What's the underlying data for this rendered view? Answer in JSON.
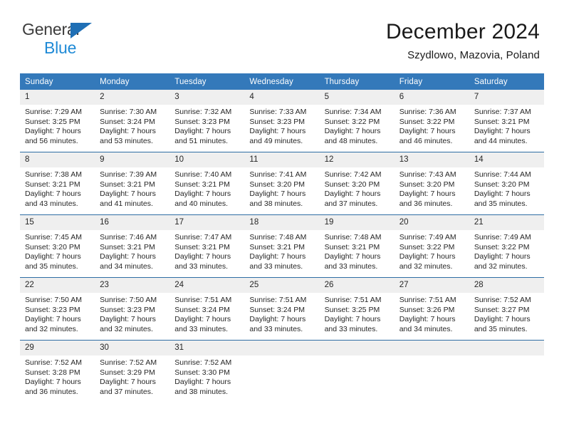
{
  "brand": {
    "line1": "General",
    "line2": "Blue",
    "logo_icon": "triangle-flag-icon",
    "color_dark": "#3c3c3c",
    "color_blue": "#1f8ad6",
    "triangle_color": "#1f6fb5"
  },
  "header": {
    "title": "December 2024",
    "subtitle": "Szydlowo, Mazovia, Poland"
  },
  "theme": {
    "header_bg": "#3479ba",
    "header_text": "#ffffff",
    "daynum_bg": "#efefef",
    "row_divider": "#2e6da4",
    "body_text": "#262626"
  },
  "weekdays": [
    "Sunday",
    "Monday",
    "Tuesday",
    "Wednesday",
    "Thursday",
    "Friday",
    "Saturday"
  ],
  "weeks": [
    [
      {
        "day": "1",
        "sunrise": "Sunrise: 7:29 AM",
        "sunset": "Sunset: 3:25 PM",
        "daylight1": "Daylight: 7 hours",
        "daylight2": "and 56 minutes."
      },
      {
        "day": "2",
        "sunrise": "Sunrise: 7:30 AM",
        "sunset": "Sunset: 3:24 PM",
        "daylight1": "Daylight: 7 hours",
        "daylight2": "and 53 minutes."
      },
      {
        "day": "3",
        "sunrise": "Sunrise: 7:32 AM",
        "sunset": "Sunset: 3:23 PM",
        "daylight1": "Daylight: 7 hours",
        "daylight2": "and 51 minutes."
      },
      {
        "day": "4",
        "sunrise": "Sunrise: 7:33 AM",
        "sunset": "Sunset: 3:23 PM",
        "daylight1": "Daylight: 7 hours",
        "daylight2": "and 49 minutes."
      },
      {
        "day": "5",
        "sunrise": "Sunrise: 7:34 AM",
        "sunset": "Sunset: 3:22 PM",
        "daylight1": "Daylight: 7 hours",
        "daylight2": "and 48 minutes."
      },
      {
        "day": "6",
        "sunrise": "Sunrise: 7:36 AM",
        "sunset": "Sunset: 3:22 PM",
        "daylight1": "Daylight: 7 hours",
        "daylight2": "and 46 minutes."
      },
      {
        "day": "7",
        "sunrise": "Sunrise: 7:37 AM",
        "sunset": "Sunset: 3:21 PM",
        "daylight1": "Daylight: 7 hours",
        "daylight2": "and 44 minutes."
      }
    ],
    [
      {
        "day": "8",
        "sunrise": "Sunrise: 7:38 AM",
        "sunset": "Sunset: 3:21 PM",
        "daylight1": "Daylight: 7 hours",
        "daylight2": "and 43 minutes."
      },
      {
        "day": "9",
        "sunrise": "Sunrise: 7:39 AM",
        "sunset": "Sunset: 3:21 PM",
        "daylight1": "Daylight: 7 hours",
        "daylight2": "and 41 minutes."
      },
      {
        "day": "10",
        "sunrise": "Sunrise: 7:40 AM",
        "sunset": "Sunset: 3:21 PM",
        "daylight1": "Daylight: 7 hours",
        "daylight2": "and 40 minutes."
      },
      {
        "day": "11",
        "sunrise": "Sunrise: 7:41 AM",
        "sunset": "Sunset: 3:20 PM",
        "daylight1": "Daylight: 7 hours",
        "daylight2": "and 38 minutes."
      },
      {
        "day": "12",
        "sunrise": "Sunrise: 7:42 AM",
        "sunset": "Sunset: 3:20 PM",
        "daylight1": "Daylight: 7 hours",
        "daylight2": "and 37 minutes."
      },
      {
        "day": "13",
        "sunrise": "Sunrise: 7:43 AM",
        "sunset": "Sunset: 3:20 PM",
        "daylight1": "Daylight: 7 hours",
        "daylight2": "and 36 minutes."
      },
      {
        "day": "14",
        "sunrise": "Sunrise: 7:44 AM",
        "sunset": "Sunset: 3:20 PM",
        "daylight1": "Daylight: 7 hours",
        "daylight2": "and 35 minutes."
      }
    ],
    [
      {
        "day": "15",
        "sunrise": "Sunrise: 7:45 AM",
        "sunset": "Sunset: 3:20 PM",
        "daylight1": "Daylight: 7 hours",
        "daylight2": "and 35 minutes."
      },
      {
        "day": "16",
        "sunrise": "Sunrise: 7:46 AM",
        "sunset": "Sunset: 3:21 PM",
        "daylight1": "Daylight: 7 hours",
        "daylight2": "and 34 minutes."
      },
      {
        "day": "17",
        "sunrise": "Sunrise: 7:47 AM",
        "sunset": "Sunset: 3:21 PM",
        "daylight1": "Daylight: 7 hours",
        "daylight2": "and 33 minutes."
      },
      {
        "day": "18",
        "sunrise": "Sunrise: 7:48 AM",
        "sunset": "Sunset: 3:21 PM",
        "daylight1": "Daylight: 7 hours",
        "daylight2": "and 33 minutes."
      },
      {
        "day": "19",
        "sunrise": "Sunrise: 7:48 AM",
        "sunset": "Sunset: 3:21 PM",
        "daylight1": "Daylight: 7 hours",
        "daylight2": "and 33 minutes."
      },
      {
        "day": "20",
        "sunrise": "Sunrise: 7:49 AM",
        "sunset": "Sunset: 3:22 PM",
        "daylight1": "Daylight: 7 hours",
        "daylight2": "and 32 minutes."
      },
      {
        "day": "21",
        "sunrise": "Sunrise: 7:49 AM",
        "sunset": "Sunset: 3:22 PM",
        "daylight1": "Daylight: 7 hours",
        "daylight2": "and 32 minutes."
      }
    ],
    [
      {
        "day": "22",
        "sunrise": "Sunrise: 7:50 AM",
        "sunset": "Sunset: 3:23 PM",
        "daylight1": "Daylight: 7 hours",
        "daylight2": "and 32 minutes."
      },
      {
        "day": "23",
        "sunrise": "Sunrise: 7:50 AM",
        "sunset": "Sunset: 3:23 PM",
        "daylight1": "Daylight: 7 hours",
        "daylight2": "and 32 minutes."
      },
      {
        "day": "24",
        "sunrise": "Sunrise: 7:51 AM",
        "sunset": "Sunset: 3:24 PM",
        "daylight1": "Daylight: 7 hours",
        "daylight2": "and 33 minutes."
      },
      {
        "day": "25",
        "sunrise": "Sunrise: 7:51 AM",
        "sunset": "Sunset: 3:24 PM",
        "daylight1": "Daylight: 7 hours",
        "daylight2": "and 33 minutes."
      },
      {
        "day": "26",
        "sunrise": "Sunrise: 7:51 AM",
        "sunset": "Sunset: 3:25 PM",
        "daylight1": "Daylight: 7 hours",
        "daylight2": "and 33 minutes."
      },
      {
        "day": "27",
        "sunrise": "Sunrise: 7:51 AM",
        "sunset": "Sunset: 3:26 PM",
        "daylight1": "Daylight: 7 hours",
        "daylight2": "and 34 minutes."
      },
      {
        "day": "28",
        "sunrise": "Sunrise: 7:52 AM",
        "sunset": "Sunset: 3:27 PM",
        "daylight1": "Daylight: 7 hours",
        "daylight2": "and 35 minutes."
      }
    ],
    [
      {
        "day": "29",
        "sunrise": "Sunrise: 7:52 AM",
        "sunset": "Sunset: 3:28 PM",
        "daylight1": "Daylight: 7 hours",
        "daylight2": "and 36 minutes."
      },
      {
        "day": "30",
        "sunrise": "Sunrise: 7:52 AM",
        "sunset": "Sunset: 3:29 PM",
        "daylight1": "Daylight: 7 hours",
        "daylight2": "and 37 minutes."
      },
      {
        "day": "31",
        "sunrise": "Sunrise: 7:52 AM",
        "sunset": "Sunset: 3:30 PM",
        "daylight1": "Daylight: 7 hours",
        "daylight2": "and 38 minutes."
      },
      {
        "day": "",
        "sunrise": "",
        "sunset": "",
        "daylight1": "",
        "daylight2": ""
      },
      {
        "day": "",
        "sunrise": "",
        "sunset": "",
        "daylight1": "",
        "daylight2": ""
      },
      {
        "day": "",
        "sunrise": "",
        "sunset": "",
        "daylight1": "",
        "daylight2": ""
      },
      {
        "day": "",
        "sunrise": "",
        "sunset": "",
        "daylight1": "",
        "daylight2": ""
      }
    ]
  ]
}
